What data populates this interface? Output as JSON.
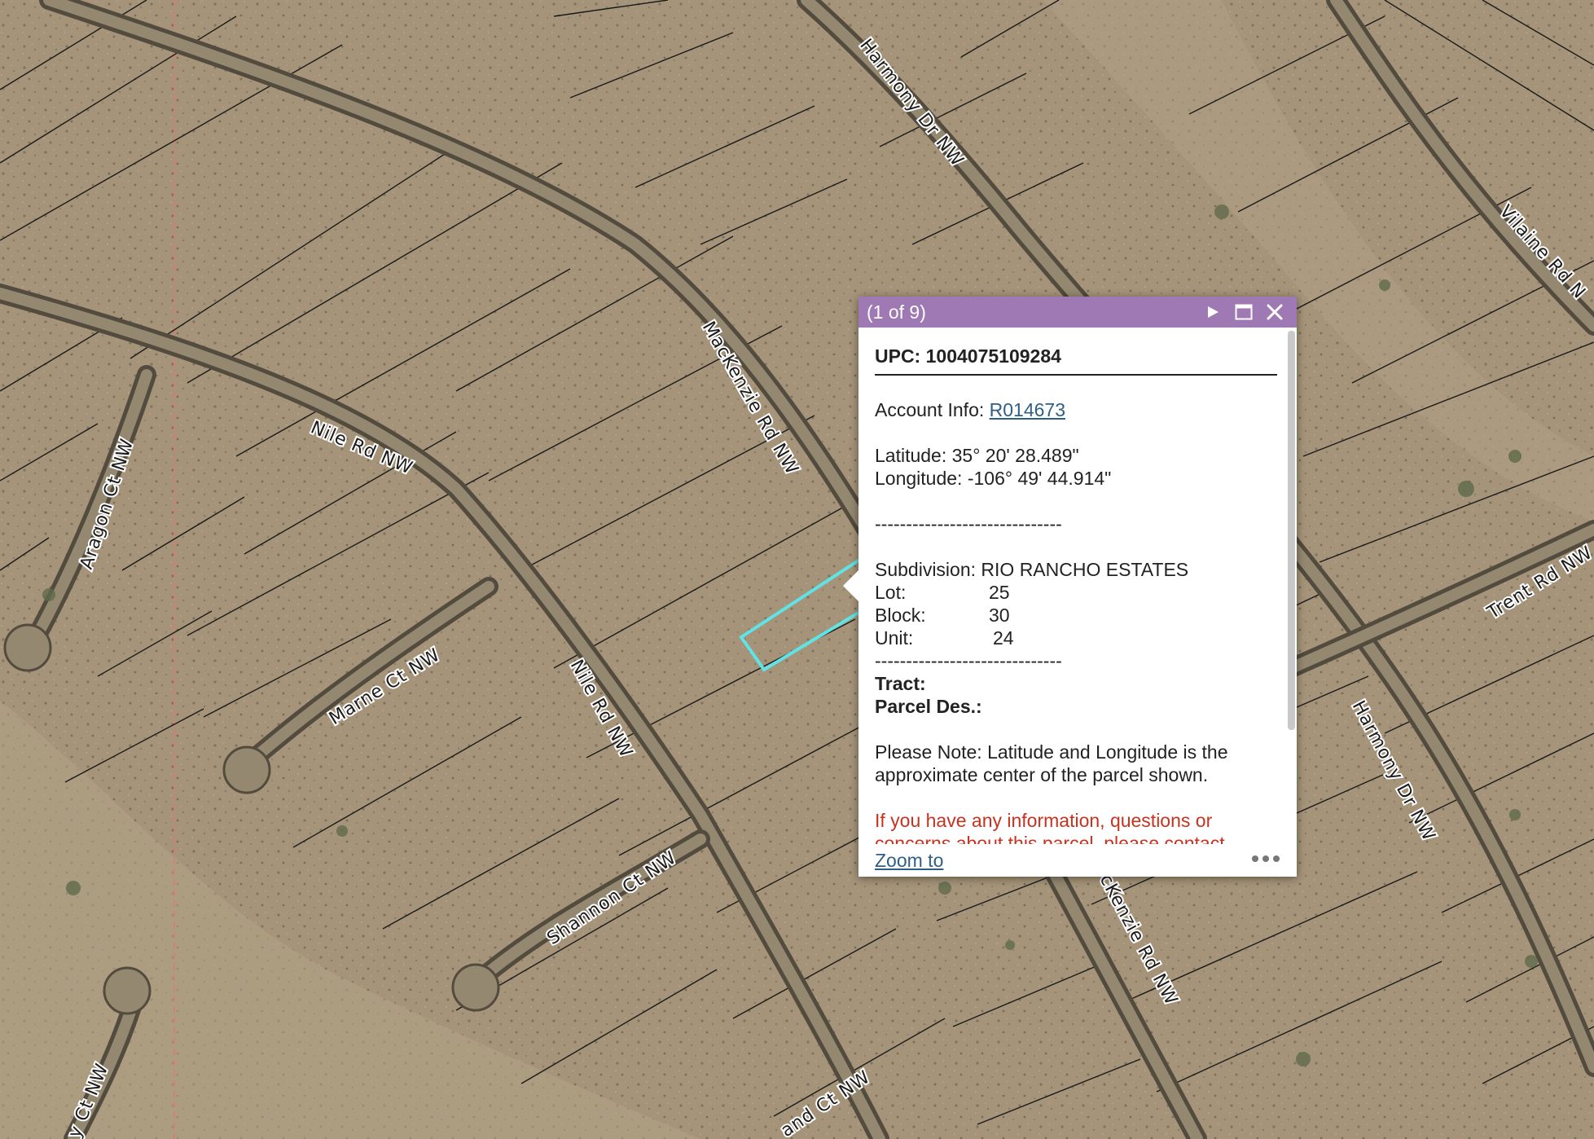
{
  "map": {
    "streets": [
      {
        "id": "harmony-dr-nw-north",
        "label": "Harmony Dr NW"
      },
      {
        "id": "vilaine-rd",
        "label": "Vilaine Rd N"
      },
      {
        "id": "mackenzie-rd-nw-north",
        "label": "MacKenzie Rd NW"
      },
      {
        "id": "nile-rd-nw-west",
        "label": "Nile Rd NW"
      },
      {
        "id": "aragon-ct-nw",
        "label": "Aragon Ct NW"
      },
      {
        "id": "marne-ct-nw",
        "label": "Marne Ct NW"
      },
      {
        "id": "nile-rd-nw-south",
        "label": "Nile Rd NW"
      },
      {
        "id": "trent-rd-nw",
        "label": "Trent Rd NW"
      },
      {
        "id": "harmony-dr-nw-south",
        "label": "Harmony Dr NW"
      },
      {
        "id": "mackenzie-rd-nw-south",
        "label": "cKenzie Rd NW"
      },
      {
        "id": "shannon-ct-nw",
        "label": "Shannon Ct NW"
      },
      {
        "id": "ct-nw-bottom-left",
        "label": "y Ct NW"
      },
      {
        "id": "ct-nw-bottom",
        "label": "and Ct NW"
      }
    ],
    "selection_color": "#5fe3e6"
  },
  "popup": {
    "header": {
      "counter": "(1 of 9)",
      "next_icon": "play-icon",
      "maximize_icon": "maximize-icon",
      "close_icon": "close-icon",
      "color": "#9e79b4"
    },
    "upc": "UPC: 1004075109284",
    "account_label": "Account Info: ",
    "account_link": "R014673",
    "latitude": "Latitude: 35° 20' 28.489\"",
    "longitude": "Longitude: -106° 49' 44.914\"",
    "separator": "------------------------------",
    "subdivision": "Subdivision: RIO RANCHO ESTATES",
    "lot": {
      "label": "Lot:",
      "value": "25"
    },
    "block": {
      "label": "Block:",
      "value": "30"
    },
    "unit": {
      "label": "Unit:",
      "value": "24"
    },
    "tract_label": "Tract:",
    "parcel_label": "Parcel Des.:",
    "note": "Please Note: Latitude and Longitude is the approximate center of the parcel shown.",
    "warning": "If you have any information, questions or concerns about this parcel, please contact",
    "footer": {
      "zoom_label": "Zoom to",
      "more_icon": "ellipsis-icon"
    }
  }
}
